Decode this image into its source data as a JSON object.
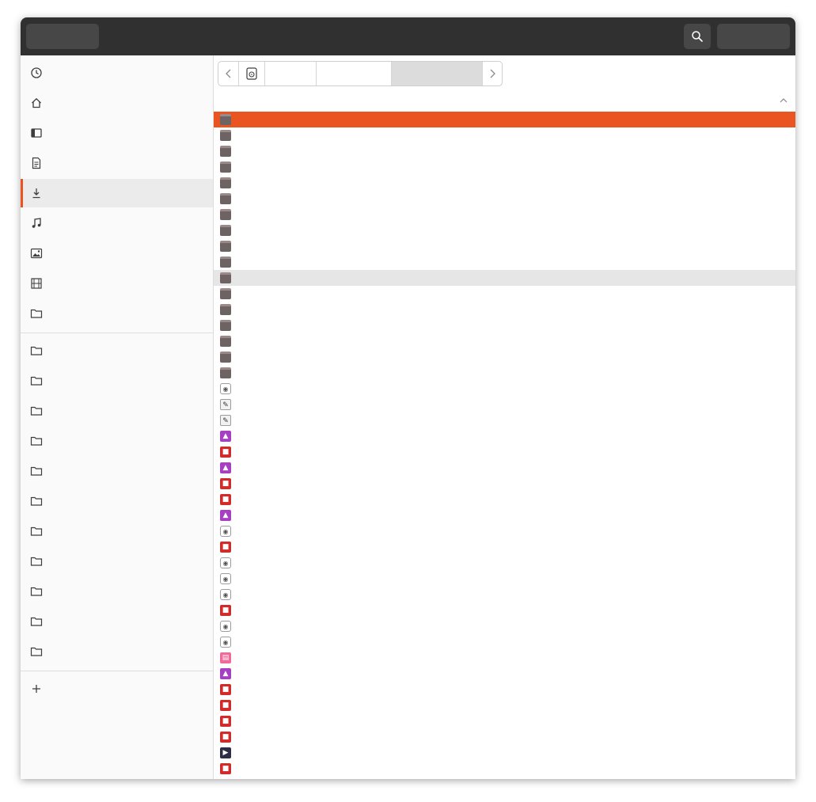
{
  "header": {
    "left_button": "",
    "right_button": ""
  },
  "sidebar": {
    "items": [
      {
        "label": "",
        "icon": "clock-icon"
      },
      {
        "label": "",
        "icon": "home-icon"
      },
      {
        "label": "",
        "icon": "desktop-icon"
      },
      {
        "label": "",
        "icon": "document-icon"
      },
      {
        "label": "",
        "icon": "download-icon",
        "active": true
      },
      {
        "label": "",
        "icon": "music-icon"
      },
      {
        "label": "",
        "icon": "picture-icon"
      },
      {
        "label": "",
        "icon": "video-icon"
      },
      {
        "label": "",
        "icon": "folder-icon"
      }
    ],
    "bookmarks": [
      {
        "label": "",
        "icon": "folder-icon"
      },
      {
        "label": "",
        "icon": "folder-icon"
      },
      {
        "label": "",
        "icon": "folder-icon"
      },
      {
        "label": "",
        "icon": "folder-icon"
      },
      {
        "label": "",
        "icon": "folder-icon"
      },
      {
        "label": "",
        "icon": "folder-icon"
      },
      {
        "label": "",
        "icon": "folder-icon"
      },
      {
        "label": "",
        "icon": "folder-icon"
      },
      {
        "label": "",
        "icon": "folder-icon"
      },
      {
        "label": "",
        "icon": "folder-icon"
      },
      {
        "label": "",
        "icon": "folder-icon"
      }
    ],
    "other": {
      "label": "",
      "icon": "plus-icon"
    }
  },
  "path": {
    "crumbs": [
      "",
      "",
      ""
    ]
  },
  "columns": {
    "name": "",
    "size": "",
    "modified": ""
  },
  "files": [
    {
      "name": "",
      "size": "",
      "modified": "",
      "type": "folder"
    },
    {
      "name": "",
      "size": "",
      "modified": "",
      "type": "folder"
    },
    {
      "name": "",
      "size": "",
      "modified": "",
      "type": "folder"
    },
    {
      "name": "",
      "size": "",
      "modified": "",
      "type": "folder"
    },
    {
      "name": "",
      "size": "",
      "modified": "",
      "type": "folder"
    },
    {
      "name": "",
      "size": "",
      "modified": "",
      "type": "folder"
    },
    {
      "name": "",
      "size": "",
      "modified": "",
      "type": "folder"
    },
    {
      "name": "",
      "size": "",
      "modified": "",
      "type": "folder"
    },
    {
      "name": "",
      "size": "",
      "modified": "",
      "type": "folder"
    },
    {
      "name": "",
      "size": "",
      "modified": "",
      "type": "folder"
    },
    {
      "name": "",
      "size": "",
      "modified": "",
      "type": "folder"
    },
    {
      "name": "",
      "size": "",
      "modified": "",
      "type": "folder"
    },
    {
      "name": "",
      "size": "",
      "modified": "",
      "type": "folder"
    },
    {
      "name": "",
      "size": "",
      "modified": "",
      "type": "folder"
    },
    {
      "name": "",
      "size": "",
      "modified": "",
      "type": "folder"
    },
    {
      "name": "",
      "size": "",
      "modified": "",
      "type": "folder"
    },
    {
      "name": "",
      "size": "",
      "modified": "",
      "type": "folder"
    },
    {
      "name": "",
      "size": "",
      "modified": " ",
      "type": "audio"
    },
    {
      "name": "",
      "size": "",
      "modified": "",
      "type": "vector"
    },
    {
      "name": "",
      "size": "",
      "modified": "",
      "type": "vector"
    },
    {
      "name": "",
      "size": "",
      "modified": "",
      "type": "image"
    },
    {
      "name": "",
      "size": "",
      "modified": "",
      "type": "pdf"
    },
    {
      "name": "",
      "size": "",
      "modified": "",
      "type": "image"
    },
    {
      "name": "",
      "size": "",
      "modified": "",
      "type": "pdf"
    },
    {
      "name": "",
      "size": "",
      "modified": "",
      "type": "pdf"
    },
    {
      "name": "",
      "size": "",
      "modified": "",
      "type": "image"
    },
    {
      "name": "",
      "size": "",
      "modified": "",
      "type": "audio"
    },
    {
      "name": "",
      "size": "",
      "modified": "",
      "type": "pdf"
    },
    {
      "name": "",
      "size": "",
      "modified": "",
      "type": "audio"
    },
    {
      "name": "",
      "size": "",
      "modified": "",
      "type": "audio"
    },
    {
      "name": "",
      "size": "",
      "modified": "",
      "type": "audio"
    },
    {
      "name": "",
      "size": "",
      "modified": "",
      "type": "pdf"
    },
    {
      "name": "",
      "size": "",
      "modified": "",
      "type": "audio"
    },
    {
      "name": "",
      "size": "",
      "modified": "",
      "type": "audio"
    },
    {
      "name": "",
      "size": "",
      "modified": "",
      "type": "slides"
    },
    {
      "name": "",
      "size": "",
      "modified": "",
      "type": "image"
    },
    {
      "name": "",
      "size": "",
      "modified": "",
      "type": "pdf"
    },
    {
      "name": "",
      "size": "",
      "modified": "",
      "type": "pdf"
    },
    {
      "name": "",
      "size": "",
      "modified": "",
      "type": "pdf"
    },
    {
      "name": "",
      "size": "",
      "modified": "",
      "type": "pdf"
    },
    {
      "name": "",
      "size": "",
      "modified": "",
      "type": "video"
    },
    {
      "name": "",
      "size": "",
      "modified": "",
      "type": "pdf"
    }
  ],
  "selected_row": 0,
  "hover_row": 10,
  "colors": {
    "accent": "#e95420",
    "header": "#303030",
    "sidebar": "#fafafa"
  }
}
